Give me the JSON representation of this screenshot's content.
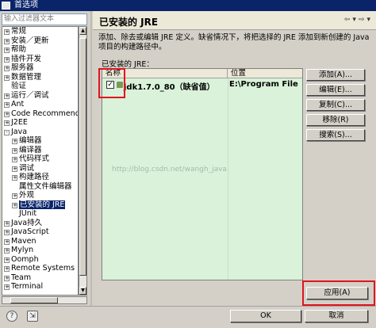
{
  "window": {
    "title": "首选项"
  },
  "filter": {
    "placeholder": "输入过滤器文本"
  },
  "tree": {
    "items": [
      {
        "label": "常规",
        "indent": 0,
        "expander": "+"
      },
      {
        "label": "安装／更新",
        "indent": 0,
        "expander": "+"
      },
      {
        "label": "帮助",
        "indent": 0,
        "expander": "+"
      },
      {
        "label": "插件开发",
        "indent": 0,
        "expander": "+"
      },
      {
        "label": "服务器",
        "indent": 0,
        "expander": "+"
      },
      {
        "label": "数据管理",
        "indent": 0,
        "expander": "+"
      },
      {
        "label": "验证",
        "indent": 0,
        "expander": ""
      },
      {
        "label": "运行／调试",
        "indent": 0,
        "expander": "+"
      },
      {
        "label": "Ant",
        "indent": 0,
        "expander": "+"
      },
      {
        "label": "Code Recommender",
        "indent": 0,
        "expander": "+"
      },
      {
        "label": "J2EE",
        "indent": 0,
        "expander": "+"
      },
      {
        "label": "Java",
        "indent": 0,
        "expander": "-"
      },
      {
        "label": "编辑器",
        "indent": 1,
        "expander": "+"
      },
      {
        "label": "编译器",
        "indent": 1,
        "expander": "+"
      },
      {
        "label": "代码样式",
        "indent": 1,
        "expander": "+"
      },
      {
        "label": "调试",
        "indent": 1,
        "expander": "+"
      },
      {
        "label": "构建路径",
        "indent": 1,
        "expander": "+"
      },
      {
        "label": "属性文件编辑器",
        "indent": 1,
        "expander": ""
      },
      {
        "label": "外观",
        "indent": 1,
        "expander": "+"
      },
      {
        "label": "已安装的 JRE",
        "indent": 1,
        "expander": "+",
        "selected": true
      },
      {
        "label": "JUnit",
        "indent": 1,
        "expander": ""
      },
      {
        "label": "Java持久",
        "indent": 0,
        "expander": "+"
      },
      {
        "label": "JavaScript",
        "indent": 0,
        "expander": "+"
      },
      {
        "label": "Maven",
        "indent": 0,
        "expander": "+"
      },
      {
        "label": "Mylyn",
        "indent": 0,
        "expander": "+"
      },
      {
        "label": "Oomph",
        "indent": 0,
        "expander": "+"
      },
      {
        "label": "Remote Systems",
        "indent": 0,
        "expander": "+"
      },
      {
        "label": "Team",
        "indent": 0,
        "expander": "+"
      },
      {
        "label": "Terminal",
        "indent": 0,
        "expander": "+"
      }
    ]
  },
  "page": {
    "title": "已安装的 JRE",
    "description": "添加、除去或编辑 JRE 定义。缺省情况下，将把选择的 JRE 添加到新创建的 Java 项目的构建路径中。",
    "table_label": "已安装的 JRE：",
    "columns": [
      "名称",
      "位置"
    ],
    "rows": [
      {
        "name": "jdk1.7.0_80（缺省值）",
        "location": "E:\\Program File",
        "checked": true
      }
    ],
    "watermark": "http://blog.csdn.net/wangh_java"
  },
  "side_buttons": {
    "add": "添加(A)...",
    "edit": "编辑(E)...",
    "copy": "复制(C)...",
    "remove": "移除(R)",
    "search": "搜索(S)..."
  },
  "apply_button": "应用(A)",
  "ok_button": "OK",
  "cancel_button": "取消",
  "colors": {
    "accent": "#0a246a",
    "table_bg": "#d9f2d9",
    "highlight": "#e0141e"
  }
}
